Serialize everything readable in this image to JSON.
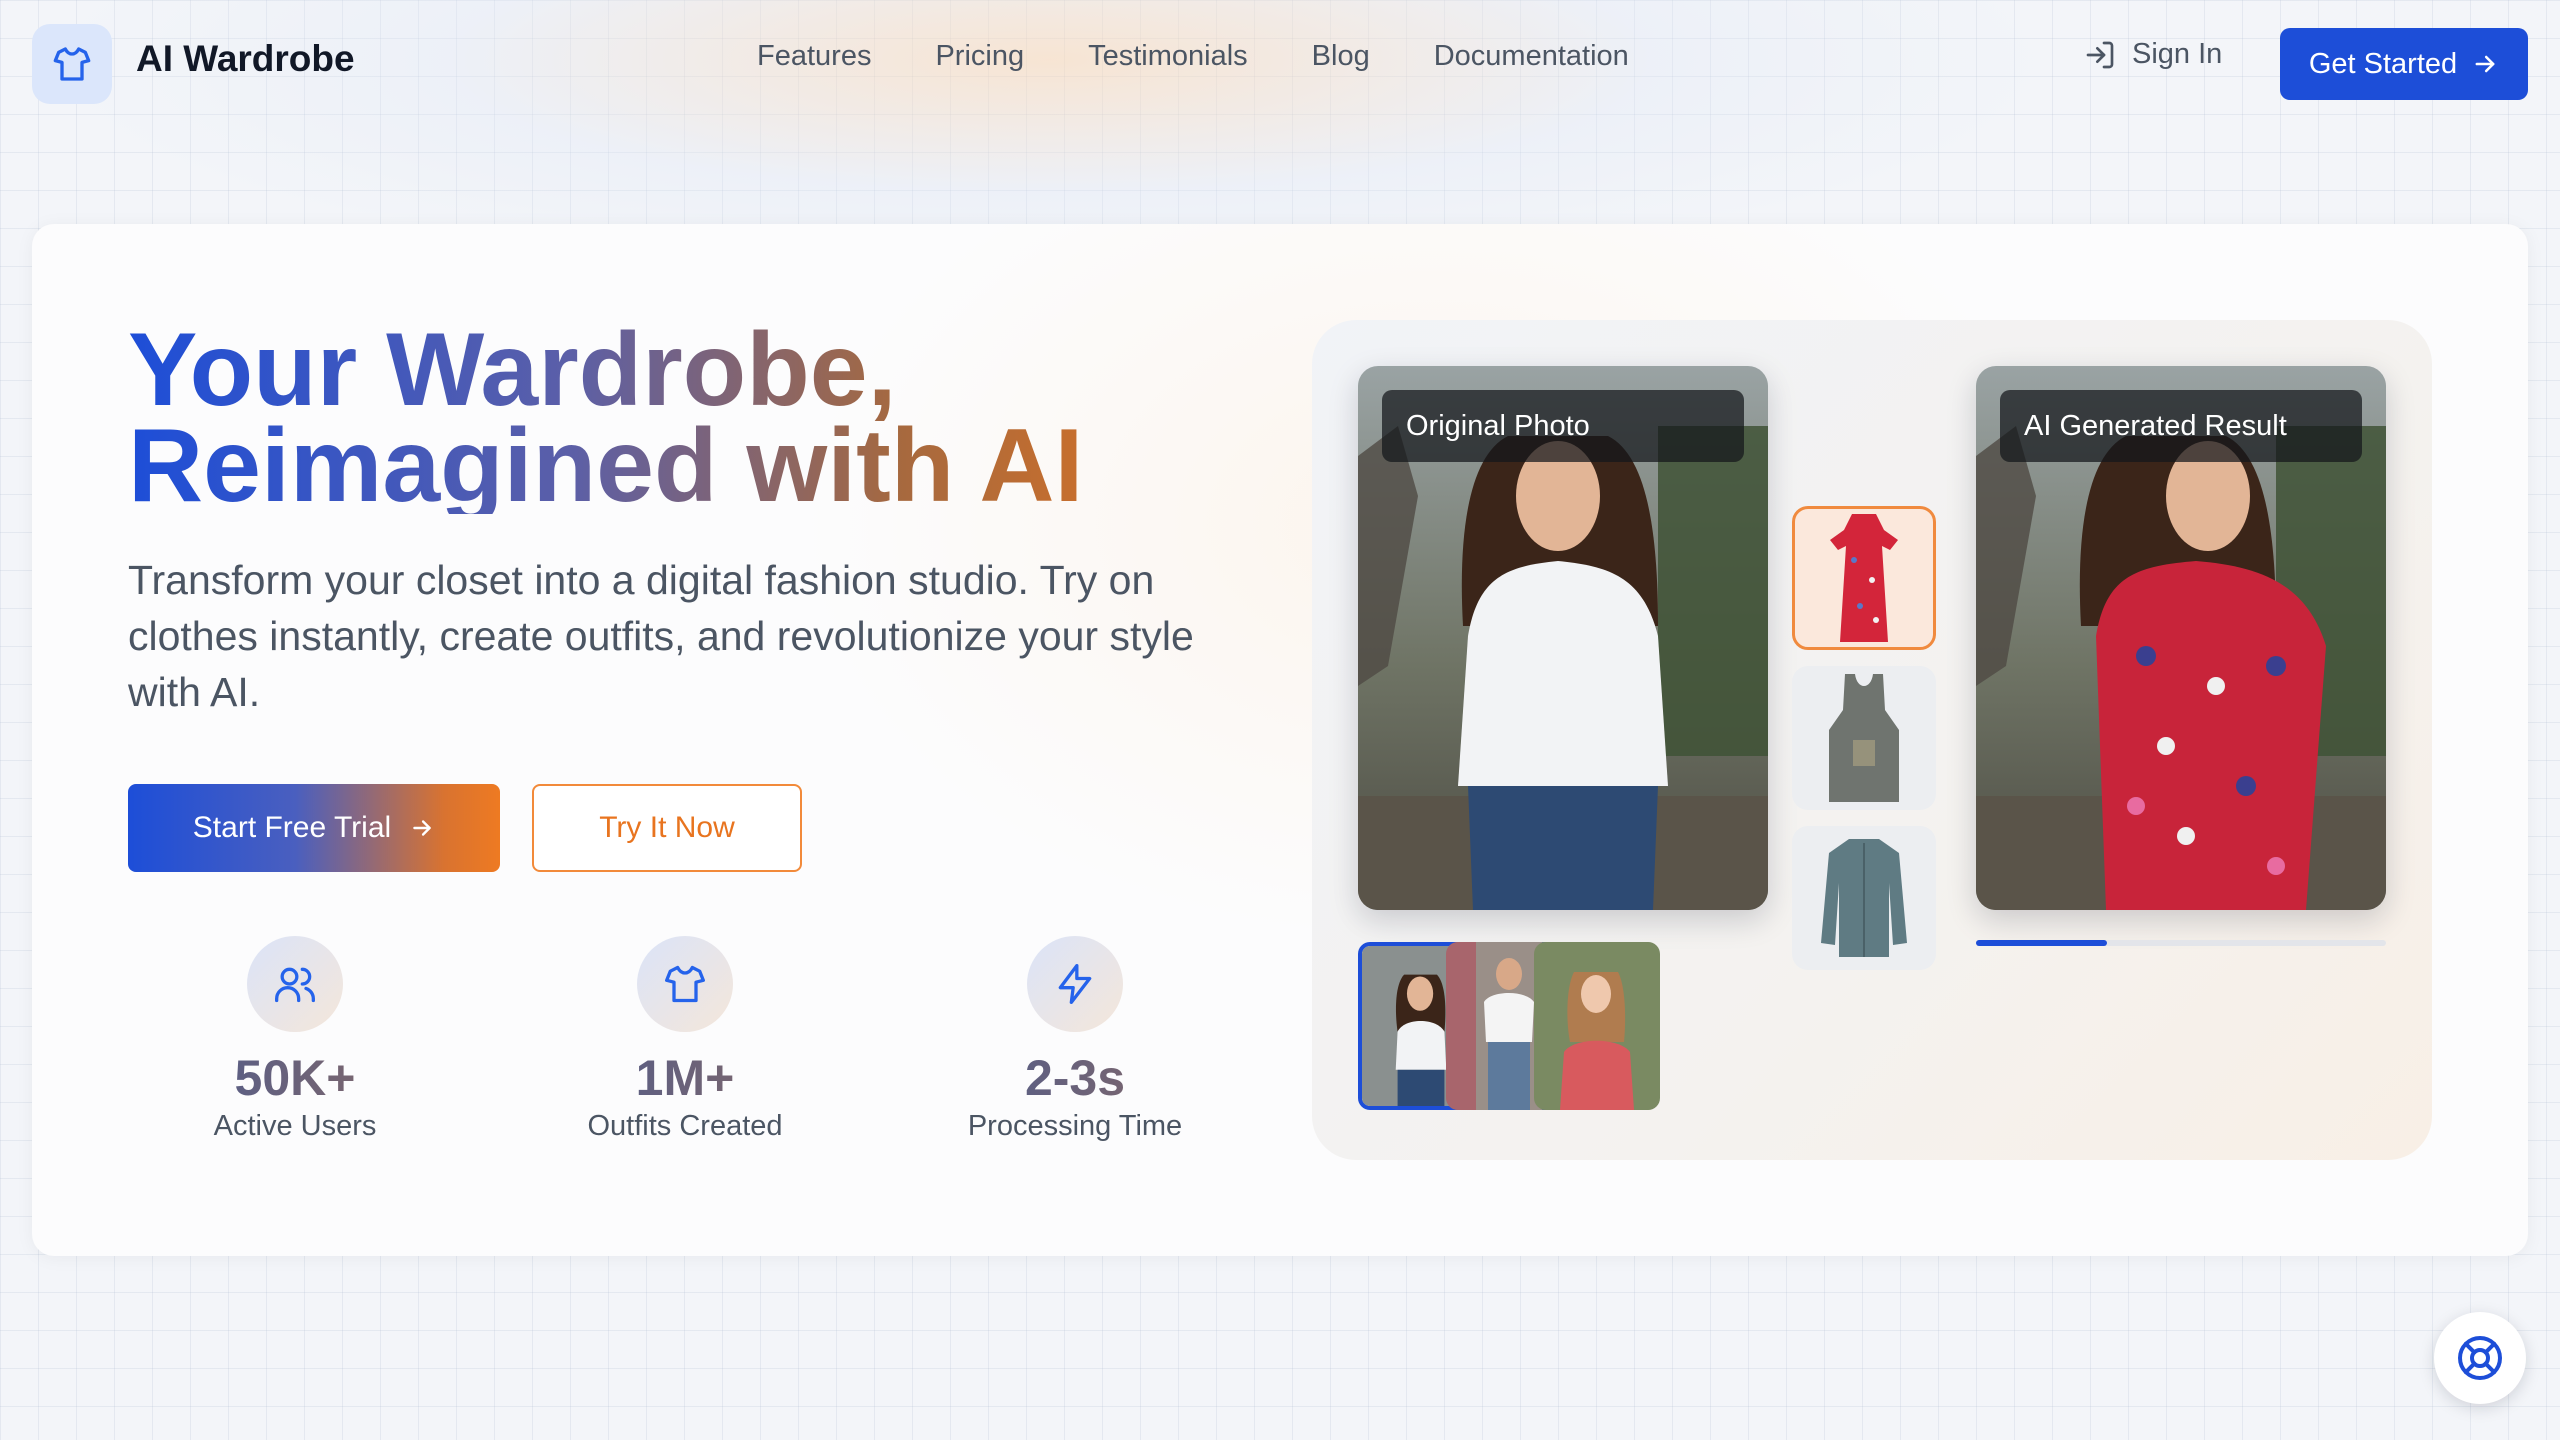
{
  "brand": {
    "name": "AI Wardrobe",
    "logo_icon": "shirt-icon"
  },
  "nav": {
    "links": [
      "Features",
      "Pricing",
      "Testimonials",
      "Blog",
      "Documentation"
    ],
    "sign_in": "Sign In",
    "get_started": "Get Started"
  },
  "hero": {
    "headline_line1": "Your Wardrobe,",
    "headline_line2": "Reimagined with AI",
    "subtitle": "Transform your closet into a digital fashion studio. Try on clothes instantly, create outfits, and revolutionize your style with AI.",
    "primary_cta": "Start Free Trial",
    "secondary_cta": "Try It Now",
    "stats": [
      {
        "value": "50K+",
        "label": "Active Users",
        "icon": "users-icon"
      },
      {
        "value": "1M+",
        "label": "Outfits Created",
        "icon": "shirt-icon"
      },
      {
        "value": "2-3s",
        "label": "Processing Time",
        "icon": "lightning-icon"
      }
    ]
  },
  "demo": {
    "original_label": "Original Photo",
    "result_label": "AI Generated Result",
    "clothing_options": [
      "red-floral-dress",
      "gray-tank-top",
      "teal-shirt"
    ],
    "selected_clothing": 0,
    "photo_thumbnails": [
      "woman-white-shirt",
      "man-white-tshirt",
      "woman-red-top"
    ],
    "selected_thumbnail": 0,
    "progress": 0.32
  },
  "colors": {
    "primary": "#1d4ed8",
    "accent": "#ee7a22"
  }
}
